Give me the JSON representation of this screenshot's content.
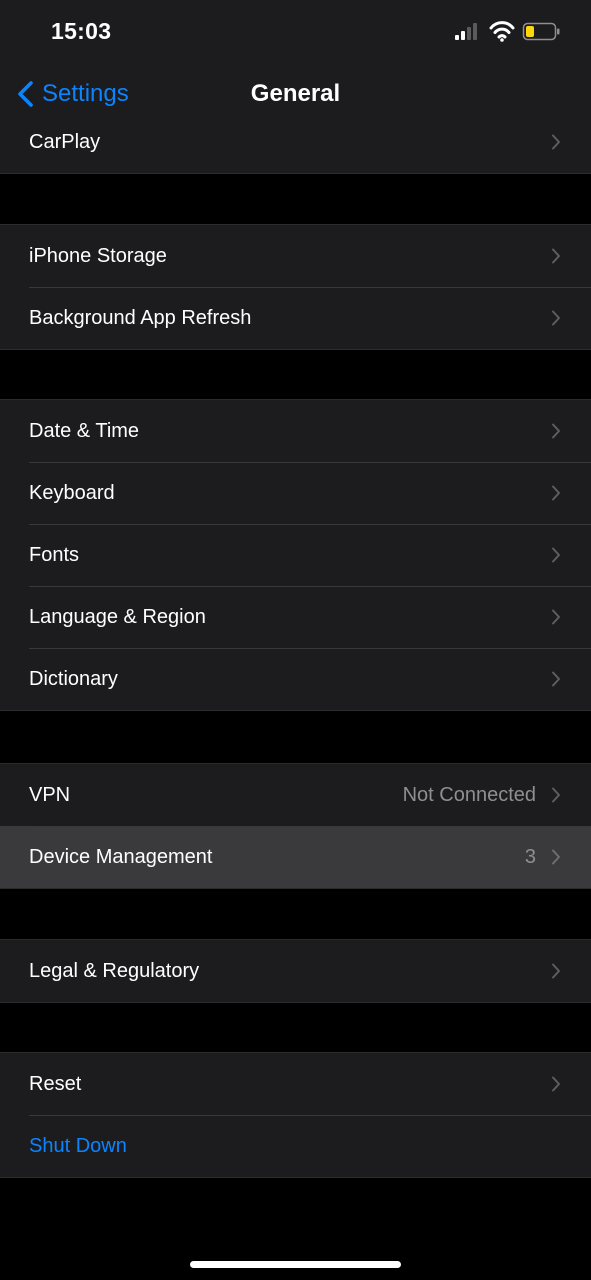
{
  "status_bar": {
    "time": "15:03"
  },
  "nav": {
    "back_label": "Settings",
    "title": "General"
  },
  "groups": [
    {
      "rows": [
        {
          "label": "CarPlay"
        }
      ]
    },
    {
      "rows": [
        {
          "label": "iPhone Storage"
        },
        {
          "label": "Background App Refresh"
        }
      ]
    },
    {
      "rows": [
        {
          "label": "Date & Time"
        },
        {
          "label": "Keyboard"
        },
        {
          "label": "Fonts"
        },
        {
          "label": "Language & Region"
        },
        {
          "label": "Dictionary"
        }
      ]
    },
    {
      "rows": [
        {
          "label": "VPN",
          "value": "Not Connected"
        },
        {
          "label": "Device Management",
          "value": "3"
        }
      ]
    },
    {
      "rows": [
        {
          "label": "Legal & Regulatory"
        }
      ]
    },
    {
      "rows": [
        {
          "label": "Reset"
        },
        {
          "label": "Shut Down"
        }
      ]
    }
  ],
  "colors": {
    "accent": "#0a84ff",
    "cell_bg": "#1c1c1e",
    "background": "#000000",
    "battery": "#ffd60a"
  },
  "icons": [
    "cellular-signal-icon",
    "wifi-icon",
    "battery-icon",
    "chevron-left-icon",
    "chevron-right-icon"
  ]
}
